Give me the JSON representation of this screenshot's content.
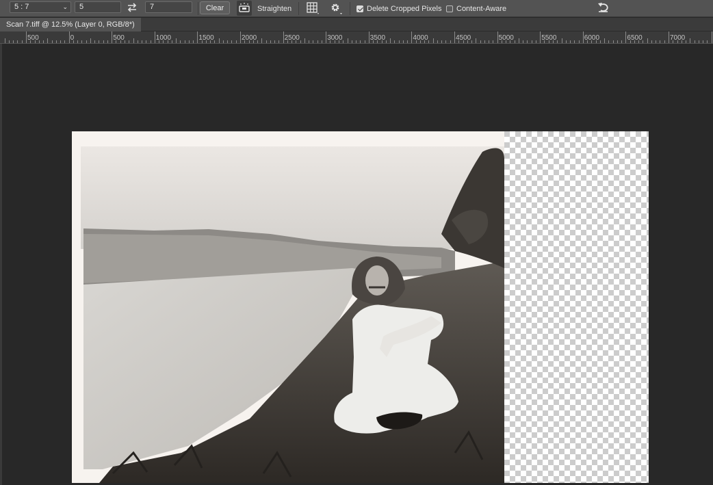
{
  "options_bar": {
    "ratio_preset": "5 : 7",
    "width_value": "5",
    "height_value": "7",
    "clear_label": "Clear",
    "straighten_label": "Straighten",
    "delete_cropped_label": "Delete Cropped Pixels",
    "delete_cropped_checked": true,
    "content_aware_label": "Content-Aware",
    "content_aware_checked": false
  },
  "document_tab": {
    "title": "Scan 7.tiff @ 12.5% (Layer 0, RGB/8*)"
  },
  "ruler": {
    "labels": [
      "500",
      "0",
      "500",
      "1000",
      "1500",
      "2000",
      "2500",
      "3000",
      "3500",
      "4000",
      "4500",
      "5000",
      "5500",
      "6000",
      "6500",
      "7000"
    ]
  },
  "colors": {
    "panel": "#535353",
    "canvas_bg": "#282828",
    "ruler": "#3a3a3a"
  },
  "icons": {
    "swap": "swap-arrows-icon",
    "straighten": "level-icon",
    "overlay": "grid-icon",
    "settings": "gear-icon",
    "reset": "undo-icon"
  }
}
